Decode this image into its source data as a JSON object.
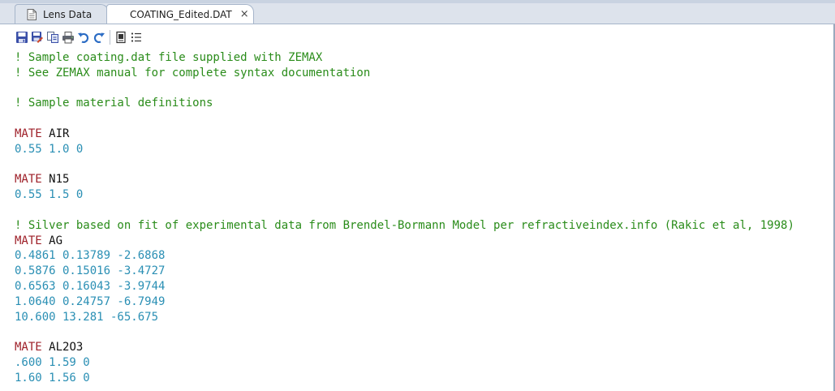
{
  "tabs": [
    {
      "label": "Lens Data",
      "active": false,
      "icon": "document-icon"
    },
    {
      "label": "COATING_Edited.DAT",
      "active": true,
      "close": "×"
    }
  ],
  "toolbar": [
    "save-icon",
    "save-as-icon",
    "copy-icon",
    "print-icon",
    "undo-icon",
    "redo-icon",
    "window-icon",
    "list-icon"
  ],
  "colors": {
    "comment": "#2a8c1a",
    "keyword": "#9e1f28",
    "number": "#2a8fb4",
    "text": "#111111"
  },
  "lines": [
    {
      "type": "comment",
      "text": "! Sample coating.dat file supplied with ZEMAX"
    },
    {
      "type": "comment",
      "text": "! See ZEMAX manual for complete syntax documentation"
    },
    {
      "type": "blank",
      "text": ""
    },
    {
      "type": "comment",
      "text": "! Sample material definitions"
    },
    {
      "type": "blank",
      "text": ""
    },
    {
      "type": "mate",
      "keyword": "MATE",
      "name": "AIR"
    },
    {
      "type": "data",
      "text": "0.55 1.0 0"
    },
    {
      "type": "blank",
      "text": ""
    },
    {
      "type": "mate",
      "keyword": "MATE",
      "name": "N15"
    },
    {
      "type": "data",
      "text": "0.55 1.5 0"
    },
    {
      "type": "blank",
      "text": ""
    },
    {
      "type": "comment",
      "text": "! Silver based on fit of experimental data from Brendel-Bormann Model per refractiveindex.info (Rakic et al, 1998)"
    },
    {
      "type": "mate",
      "keyword": "MATE",
      "name": "AG"
    },
    {
      "type": "data",
      "text": "0.4861 0.13789 -2.6868"
    },
    {
      "type": "data",
      "text": "0.5876 0.15016 -3.4727"
    },
    {
      "type": "data",
      "text": "0.6563 0.16043 -3.9744"
    },
    {
      "type": "data",
      "text": "1.0640 0.24757 -6.7949"
    },
    {
      "type": "data",
      "text": "10.600 13.281 -65.675"
    },
    {
      "type": "blank",
      "text": ""
    },
    {
      "type": "mate",
      "keyword": "MATE",
      "name": "AL2O3"
    },
    {
      "type": "data",
      "text": ".600 1.59 0"
    },
    {
      "type": "data",
      "text": "1.60 1.56 0"
    }
  ]
}
